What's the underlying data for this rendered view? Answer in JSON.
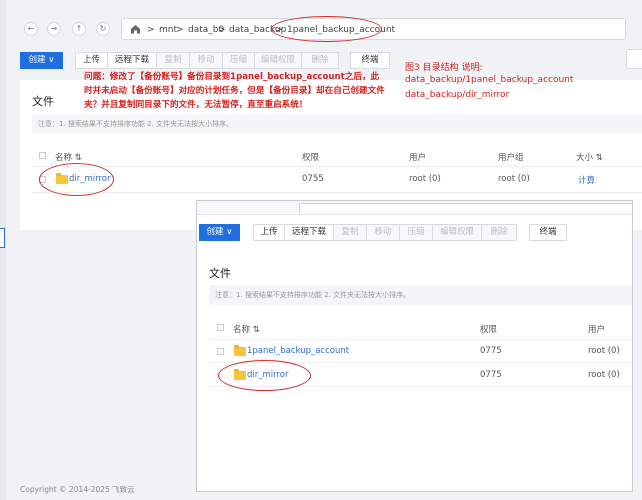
{
  "toolbar": {
    "path": [
      "mnt",
      "data_b0",
      "data_backup",
      "1panel_backup_account"
    ],
    "separator": ">",
    "create_label": "创建",
    "create_arrow": "∨",
    "buttons": [
      "上传",
      "远程下载",
      "复制",
      "移动",
      "压缩",
      "编辑权限",
      "删除",
      "终端"
    ],
    "nav": [
      "←",
      "→",
      "↑",
      "↻"
    ]
  },
  "main": {
    "title": "文件",
    "note": "注意：1. 搜索结果不支持排序功能 2. 文件夹无法按大小排序。",
    "columns": [
      "名称",
      "权限",
      "用户",
      "用户组",
      "大小"
    ],
    "sort_icon": "⇅",
    "rows": [
      {
        "name": "dir_mirror",
        "perm": "0755",
        "user": "root (0)",
        "group": "root (0)",
        "size": "计算"
      }
    ]
  },
  "annotation": {
    "problem": "问题：修改了【备份账号】备份目录到1panel_backup_account之后，此时并未启动【备份账号】对应的计划任务，但是【备份目录】却在自己创建文件夹？并且复制同目录下的文件，无法暂停，直至重启系统！",
    "caption": "图3 目录结构 说明:",
    "structure": [
      "data_backup/1panel_backup_account",
      "data_backup/dir_mirror"
    ]
  },
  "overlay": {
    "create_label": "创建",
    "create_arrow": "∨",
    "buttons": [
      "上传",
      "远程下载",
      "复制",
      "移动",
      "压缩",
      "编辑权限",
      "删除",
      "终端"
    ],
    "title": "文件",
    "note": "注意：1. 搜索结果不支持排序功能 2. 文件夹无法按大小排序。",
    "columns": [
      "名称",
      "权限",
      "用户"
    ],
    "sort_icon": "⇅",
    "rows": [
      {
        "name": "1panel_backup_account",
        "perm": "0775",
        "user": "root (0)"
      },
      {
        "name": "dir_mirror",
        "perm": "0775",
        "user": "root (0)"
      }
    ]
  },
  "footer": {
    "copyright": "Copyright © 2014-2025 飞致云"
  },
  "colors": {
    "primary": "#1f6fe0",
    "annotation_red": "#d42a2a",
    "folder": "#f7c53c"
  }
}
